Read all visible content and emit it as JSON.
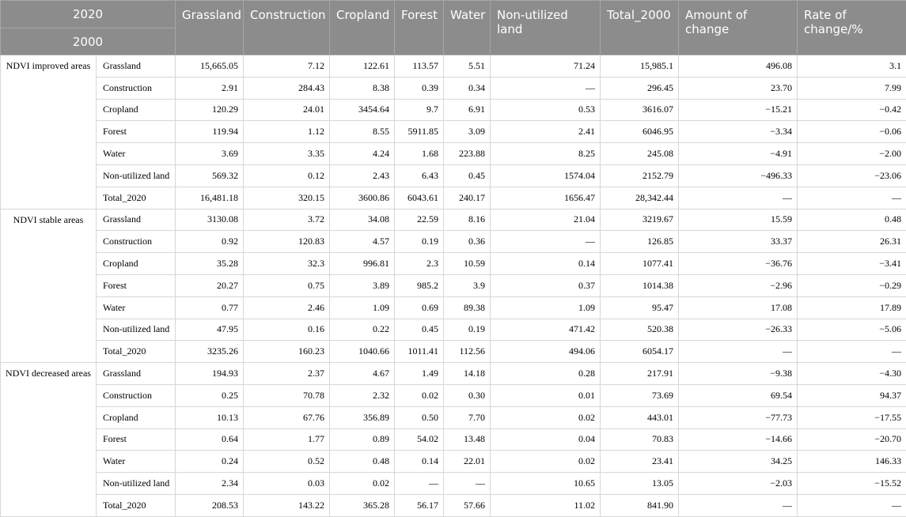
{
  "header": {
    "corner_top": "2020",
    "corner_bottom": "2000",
    "columns": [
      "Grassland",
      "Construction",
      "Cropland",
      "Forest",
      "Water",
      "Non-utilized land",
      "Total_2000",
      "Amount of change",
      "Rate of change/%"
    ]
  },
  "groups": [
    {
      "label": "NDVI improved areas",
      "rows": [
        {
          "class": "Grassland",
          "values": [
            "15,665.05",
            "7.12",
            "122.61",
            "113.57",
            "5.51",
            "71.24",
            "15,985.1",
            "496.08",
            "3.1"
          ]
        },
        {
          "class": "Construction",
          "values": [
            "2.91",
            "284.43",
            "8.38",
            "0.39",
            "0.34",
            "—",
            "296.45",
            "23.70",
            "7.99"
          ]
        },
        {
          "class": "Cropland",
          "values": [
            "120.29",
            "24.01",
            "3454.64",
            "9.7",
            "6.91",
            "0.53",
            "3616.07",
            "−15.21",
            "−0.42"
          ]
        },
        {
          "class": "Forest",
          "values": [
            "119.94",
            "1.12",
            "8.55",
            "5911.85",
            "3.09",
            "2.41",
            "6046.95",
            "−3.34",
            "−0.06"
          ]
        },
        {
          "class": "Water",
          "values": [
            "3.69",
            "3.35",
            "4.24",
            "1.68",
            "223.88",
            "8.25",
            "245.08",
            "−4.91",
            "−2.00"
          ]
        },
        {
          "class": "Non-utilized land",
          "values": [
            "569.32",
            "0.12",
            "2.43",
            "6.43",
            "0.45",
            "1574.04",
            "2152.79",
            "−496.33",
            "−23.06"
          ]
        },
        {
          "class": "Total_2020",
          "values": [
            "16,481.18",
            "320.15",
            "3600.86",
            "6043.61",
            "240.17",
            "1656.47",
            "28,342.44",
            "—",
            "—"
          ]
        }
      ]
    },
    {
      "label": "NDVI stable areas",
      "rows": [
        {
          "class": "Grassland",
          "values": [
            "3130.08",
            "3.72",
            "34.08",
            "22.59",
            "8.16",
            "21.04",
            "3219.67",
            "15.59",
            "0.48"
          ]
        },
        {
          "class": "Construction",
          "values": [
            "0.92",
            "120.83",
            "4.57",
            "0.19",
            "0.36",
            "—",
            "126.85",
            "33.37",
            "26.31"
          ]
        },
        {
          "class": "Cropland",
          "values": [
            "35.28",
            "32.3",
            "996.81",
            "2.3",
            "10.59",
            "0.14",
            "1077.41",
            "−36.76",
            "−3.41"
          ]
        },
        {
          "class": "Forest",
          "values": [
            "20.27",
            "0.75",
            "3.89",
            "985.2",
            "3.9",
            "0.37",
            "1014.38",
            "−2.96",
            "−0.29"
          ]
        },
        {
          "class": "Water",
          "values": [
            "0.77",
            "2.46",
            "1.09",
            "0.69",
            "89.38",
            "1.09",
            "95.47",
            "17.08",
            "17.89"
          ]
        },
        {
          "class": "Non-utilized land",
          "values": [
            "47.95",
            "0.16",
            "0.22",
            "0.45",
            "0.19",
            "471.42",
            "520.38",
            "−26.33",
            "−5.06"
          ]
        },
        {
          "class": "Total_2020",
          "values": [
            "3235.26",
            "160.23",
            "1040.66",
            "1011.41",
            "112.56",
            "494.06",
            "6054.17",
            "—",
            "—"
          ]
        }
      ]
    },
    {
      "label": "NDVI decreased areas",
      "rows": [
        {
          "class": "Grassland",
          "values": [
            "194.93",
            "2.37",
            "4.67",
            "1.49",
            "14.18",
            "0.28",
            "217.91",
            "−9.38",
            "−4.30"
          ]
        },
        {
          "class": "Construction",
          "values": [
            "0.25",
            "70.78",
            "2.32",
            "0.02",
            "0.30",
            "0.01",
            "73.69",
            "69.54",
            "94.37"
          ]
        },
        {
          "class": "Cropland",
          "values": [
            "10.13",
            "67.76",
            "356.89",
            "0.50",
            "7.70",
            "0.02",
            "443.01",
            "−77.73",
            "−17.55"
          ]
        },
        {
          "class": "Forest",
          "values": [
            "0.64",
            "1.77",
            "0.89",
            "54.02",
            "13.48",
            "0.04",
            "70.83",
            "−14.66",
            "−20.70"
          ]
        },
        {
          "class": "Water",
          "values": [
            "0.24",
            "0.52",
            "0.48",
            "0.14",
            "22.01",
            "0.02",
            "23.41",
            "34.25",
            "146.33"
          ]
        },
        {
          "class": "Non-utilized land",
          "values": [
            "2.34",
            "0.03",
            "0.02",
            "—",
            "—",
            "10.65",
            "13.05",
            "−2.03",
            "−15.52"
          ]
        },
        {
          "class": "Total_2020",
          "values": [
            "208.53",
            "143.22",
            "365.28",
            "56.17",
            "57.66",
            "11.02",
            "841.90",
            "—",
            "—"
          ]
        }
      ]
    }
  ]
}
